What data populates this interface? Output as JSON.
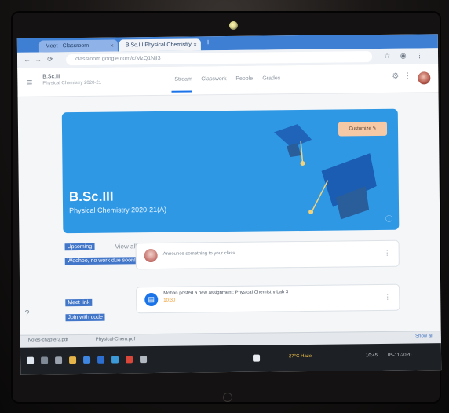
{
  "browser": {
    "tabs": [
      {
        "label": "Meet - Classroom",
        "close": "×"
      },
      {
        "label": "B.Sc.III Physical Chemistry",
        "close": "×"
      }
    ],
    "new_tab": "+",
    "url": "classroom.google.com/c/MzQ1NjI3",
    "nav_back": "←",
    "nav_forward": "→",
    "nav_reload": "⟳",
    "bar_icons": "☆ ◉ ⋮"
  },
  "header": {
    "menu": "≡",
    "class_title": "B.Sc.III",
    "class_subtitle": "Physical Chemistry 2020-21",
    "tabs": [
      "Stream",
      "Classwork",
      "People",
      "Grades"
    ],
    "icons": [
      "⚙",
      "⋮"
    ]
  },
  "banner": {
    "title": "B.Sc.III",
    "subtitle": "Physical Chemistry 2020-21(A)",
    "customize_label": "Customize ✎",
    "info_icon": "ⓘ",
    "colors": {
      "background": "#2f98e5",
      "cap": "#1f64b8"
    }
  },
  "sidebar_labels": {
    "upcoming": "Upcoming",
    "no_work": "Woohoo, no work due soon!",
    "view_all": "View all",
    "meet_link": "Meet link",
    "meet_code": "Join with code"
  },
  "feed": [
    {
      "kind": "announce",
      "text": "Announce something to your class",
      "menu": "⋮"
    },
    {
      "kind": "assignment",
      "title": "Mohan posted a new assignment: Physical Chemistry Lab 3",
      "date": "10:30",
      "menu": "⋮"
    }
  ],
  "download_bar": {
    "items": [
      "Notes-chapter3.pdf",
      "Physical-Chem.pdf"
    ],
    "show_all": "Show all"
  },
  "taskbar": {
    "tray_text": "27°C Haze",
    "clock": "10:45",
    "date": "05-11-2020"
  },
  "left_icon": "?"
}
